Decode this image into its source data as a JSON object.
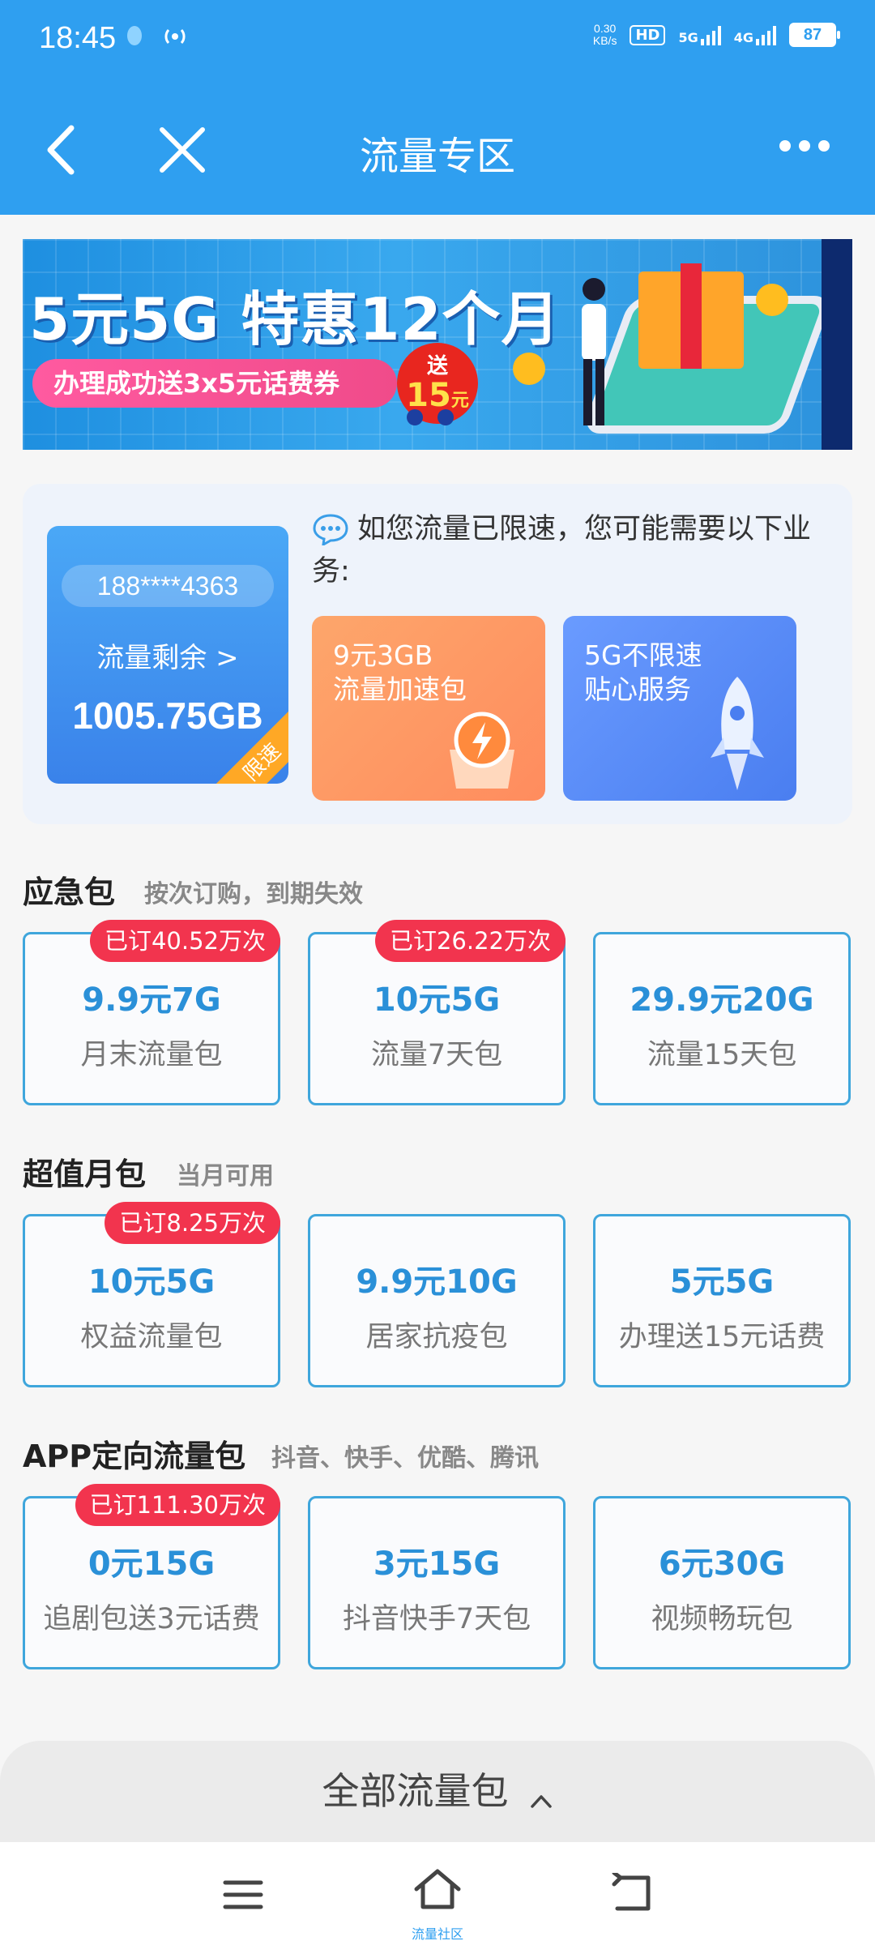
{
  "status": {
    "time": "18:45",
    "net_speed_value": "0.30",
    "net_speed_unit": "KB/s",
    "hd_label": "HD",
    "sim1_type": "5G",
    "sim2_type": "4G",
    "battery": "87"
  },
  "nav": {
    "title": "流量专区"
  },
  "banner": {
    "title": "5元5G 特惠12个月",
    "pill_text": "办理成功送3x5元话费券",
    "badge_top": "送",
    "badge_value": "15",
    "badge_unit": "元"
  },
  "account": {
    "phone": "188****4363",
    "remaining_label": "流量剩余 >",
    "remaining_value": "1005.75GB",
    "limit_tag": "限速"
  },
  "tip": {
    "line1": "如您流量已限速，您可能需要以下业",
    "line2": "务:"
  },
  "promos": [
    {
      "line1": "9元3GB",
      "line2": "流量加速包"
    },
    {
      "line1": "5G不限速",
      "line2": "贴心服务"
    }
  ],
  "sections": [
    {
      "title": "应急包",
      "subtitle": "按次订购，到期失效",
      "items": [
        {
          "price": "9.9元7G",
          "desc": "月末流量包",
          "badge": "已订40.52万次"
        },
        {
          "price": "10元5G",
          "desc": "流量7天包",
          "badge": "已订26.22万次"
        },
        {
          "price": "29.9元20G",
          "desc": "流量15天包",
          "badge": ""
        }
      ]
    },
    {
      "title": "超值月包",
      "subtitle": "当月可用",
      "items": [
        {
          "price": "10元5G",
          "desc": "权益流量包",
          "badge": "已订8.25万次"
        },
        {
          "price": "9.9元10G",
          "desc": "居家抗疫包",
          "badge": ""
        },
        {
          "price": "5元5G",
          "desc": "办理送15元话费",
          "badge": ""
        }
      ]
    },
    {
      "title": "APP定向流量包",
      "subtitle": "抖音、快手、优酷、腾讯",
      "items": [
        {
          "price": "0元15G",
          "desc": "追剧包送3元话费",
          "badge": "已订111.30万次"
        },
        {
          "price": "3元15G",
          "desc": "抖音快手7天包",
          "badge": ""
        },
        {
          "price": "6元30G",
          "desc": "视频畅玩包",
          "badge": ""
        }
      ]
    }
  ],
  "footer": {
    "all_packs_label": "全部流量包",
    "home_label": "流量社区"
  },
  "colors": {
    "header": "#2f9ff0",
    "price": "#2a90d8",
    "badge": "#f2344e",
    "card_border": "#3fa6dc"
  }
}
